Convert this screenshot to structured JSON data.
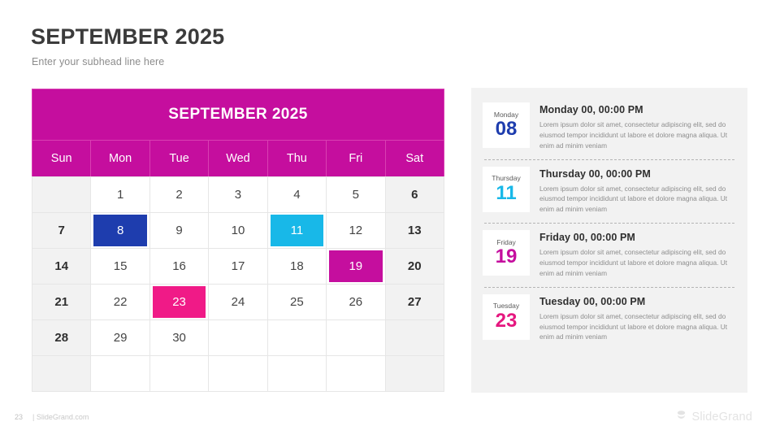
{
  "slide": {
    "title": "SEPTEMBER 2025",
    "subhead": "Enter your subhead line here"
  },
  "calendar": {
    "month_title": "SEPTEMBER 2025",
    "weekday_headers": [
      "Sun",
      "Mon",
      "Tue",
      "Wed",
      "Thu",
      "Fri",
      "Sat"
    ],
    "weeks": [
      [
        {
          "day": "",
          "type": "empty-weekend"
        },
        {
          "day": "1",
          "type": "normal"
        },
        {
          "day": "2",
          "type": "normal"
        },
        {
          "day": "3",
          "type": "normal"
        },
        {
          "day": "4",
          "type": "normal"
        },
        {
          "day": "5",
          "type": "normal"
        },
        {
          "day": "6",
          "type": "weekend"
        }
      ],
      [
        {
          "day": "7",
          "type": "weekend"
        },
        {
          "day": "8",
          "type": "highlight",
          "highlight": "hl-blue"
        },
        {
          "day": "9",
          "type": "normal"
        },
        {
          "day": "10",
          "type": "normal"
        },
        {
          "day": "11",
          "type": "highlight",
          "highlight": "hl-cyan"
        },
        {
          "day": "12",
          "type": "normal"
        },
        {
          "day": "13",
          "type": "weekend"
        }
      ],
      [
        {
          "day": "14",
          "type": "weekend"
        },
        {
          "day": "15",
          "type": "normal"
        },
        {
          "day": "16",
          "type": "normal"
        },
        {
          "day": "17",
          "type": "normal"
        },
        {
          "day": "18",
          "type": "normal"
        },
        {
          "day": "19",
          "type": "highlight",
          "highlight": "hl-magenta"
        },
        {
          "day": "20",
          "type": "weekend"
        }
      ],
      [
        {
          "day": "21",
          "type": "weekend"
        },
        {
          "day": "22",
          "type": "normal"
        },
        {
          "day": "23",
          "type": "highlight",
          "highlight": "hl-pink"
        },
        {
          "day": "24",
          "type": "normal"
        },
        {
          "day": "25",
          "type": "normal"
        },
        {
          "day": "26",
          "type": "normal"
        },
        {
          "day": "27",
          "type": "weekend"
        }
      ],
      [
        {
          "day": "28",
          "type": "weekend"
        },
        {
          "day": "29",
          "type": "normal"
        },
        {
          "day": "30",
          "type": "normal"
        },
        {
          "day": "",
          "type": "empty"
        },
        {
          "day": "",
          "type": "empty"
        },
        {
          "day": "",
          "type": "empty"
        },
        {
          "day": "",
          "type": "empty-weekend"
        }
      ],
      [
        {
          "day": "",
          "type": "empty-weekend"
        },
        {
          "day": "",
          "type": "empty"
        },
        {
          "day": "",
          "type": "empty"
        },
        {
          "day": "",
          "type": "empty"
        },
        {
          "day": "",
          "type": "empty"
        },
        {
          "day": "",
          "type": "empty"
        },
        {
          "day": "",
          "type": "empty-weekend"
        }
      ]
    ],
    "colors": {
      "header": "#c50e9e",
      "blue": "#1e3dae",
      "cyan": "#18b8e8",
      "magenta": "#c50e9e",
      "pink": "#f01a87",
      "weekend_bg": "#f2f2f2"
    }
  },
  "events": [
    {
      "weekday": "Monday",
      "day": "08",
      "color_class": "dn-blue",
      "title": "Monday 00, 00:00 PM",
      "description": "Lorem ipsum dolor sit amet, consectetur adipiscing elit, sed do eiusmod tempor incididunt ut labore et dolore magna aliqua. Ut enim ad minim veniam"
    },
    {
      "weekday": "Thursday",
      "day": "11",
      "color_class": "dn-cyan",
      "title": "Thursday 00, 00:00 PM",
      "description": "Lorem ipsum dolor sit amet, consectetur adipiscing elit, sed do eiusmod tempor incididunt ut labore et dolore magna aliqua. Ut enim ad minim veniam"
    },
    {
      "weekday": "Friday",
      "day": "19",
      "color_class": "dn-magenta",
      "title": "Friday 00, 00:00 PM",
      "description": "Lorem ipsum dolor sit amet, consectetur adipiscing elit, sed do eiusmod tempor incididunt ut labore et dolore magna aliqua. Ut enim ad minim veniam"
    },
    {
      "weekday": "Tuesday",
      "day": "23",
      "color_class": "dn-pink",
      "title": "Tuesday 00, 00:00 PM",
      "description": "Lorem ipsum dolor sit amet, consectetur adipiscing elit, sed do eiusmod tempor incididunt ut labore et dolore magna aliqua. Ut enim ad minim veniam"
    }
  ],
  "footer": {
    "page_number": "23",
    "site": "| SlideGrand.com",
    "brand_name": "SlideGrand"
  }
}
